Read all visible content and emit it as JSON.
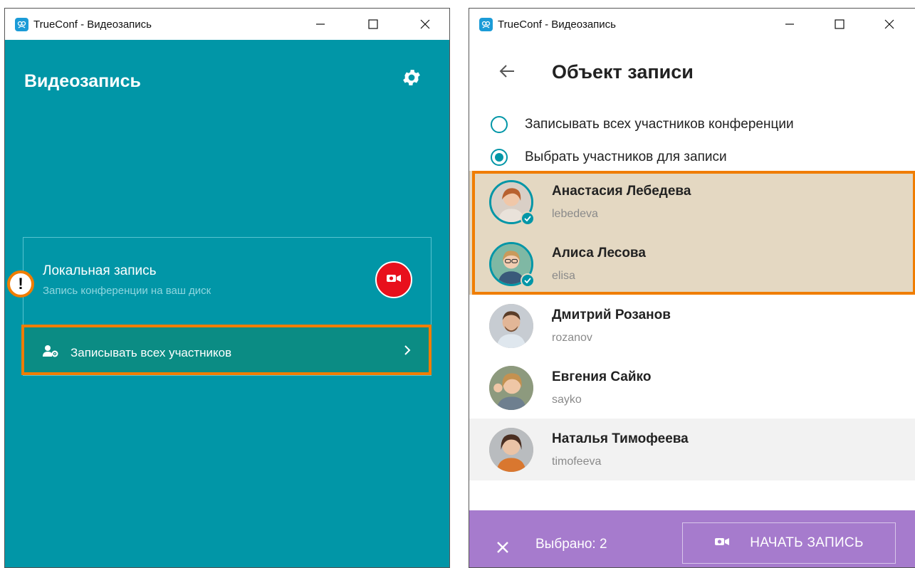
{
  "left_window": {
    "titlebar": {
      "title": "TrueConf - Видеозапись"
    },
    "header": {
      "title": "Видеозапись",
      "settings_icon": "gear-icon"
    },
    "local_recording": {
      "title": "Локальная запись",
      "subtitle": "Запись конференции на ваш диск",
      "record_icon": "video-camera-icon",
      "record_color": "#e8101c",
      "record_all_label": "Записывать всех участников",
      "warning_mark": "!"
    },
    "colors": {
      "background": "#0196a7",
      "highlight": "#f07d00"
    }
  },
  "right_window": {
    "titlebar": {
      "title": "TrueConf - Видеозапись"
    },
    "header": {
      "title": "Объект записи",
      "back_icon": "arrow-left-icon"
    },
    "options": [
      {
        "label": "Записывать всех участников конференции",
        "selected": false
      },
      {
        "label": "Выбрать участников для записи",
        "selected": true
      }
    ],
    "participants": [
      {
        "name": "Анастасия Лебедева",
        "login": "lebedeva",
        "selected": true
      },
      {
        "name": "Алиса Лесова",
        "login": "elisa",
        "selected": true
      },
      {
        "name": "Дмитрий Розанов",
        "login": "rozanov",
        "selected": false
      },
      {
        "name": "Евгения Сайко",
        "login": "sayko",
        "selected": false
      },
      {
        "name": "Наталья Тимофеева",
        "login": "timofeeva",
        "selected": false
      }
    ],
    "bottom_bar": {
      "selected_count_label": "Выбрано: 2",
      "start_label": "НАЧАТЬ ЗАПИСЬ",
      "background": "#a67bcd"
    }
  }
}
